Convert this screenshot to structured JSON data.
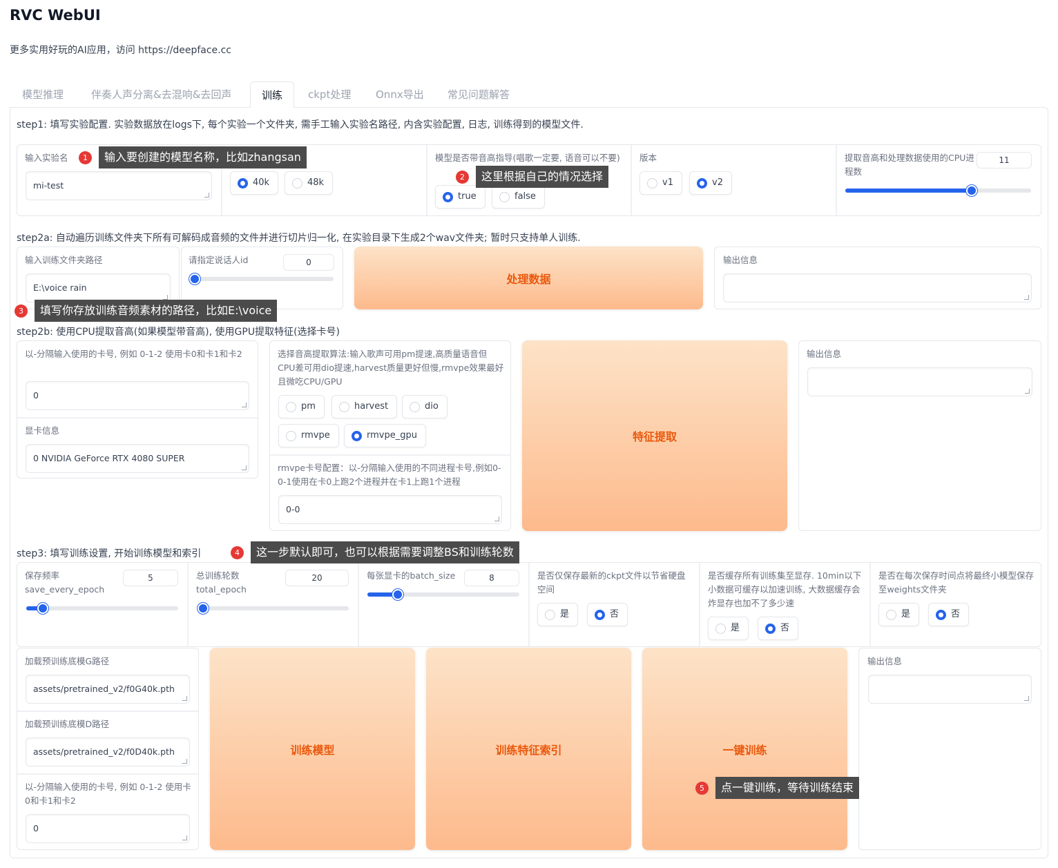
{
  "app": {
    "title": "RVC WebUI",
    "subtitle": "更多实用好玩的AI应用，访问 https://deepface.cc"
  },
  "tabs": [
    "模型推理",
    "伴奏人声分离&去混响&去回声",
    "训练",
    "ckpt处理",
    "Onnx导出",
    "常见问题解答"
  ],
  "active_tab": "训练",
  "step1": {
    "text": "step1: 填写实验配置. 实验数据放在logs下, 每个实验一个文件夹, 需手工输入实验名路径, 内含实验配置, 日志, 训练得到的模型文件.",
    "exp_name_label": "输入实验名",
    "exp_name_value": "mi-test",
    "sr_options": [
      "40k",
      "48k"
    ],
    "sr_selected": "40k",
    "pitch_label": "模型是否带音高指导(唱歌一定要, 语音可以不要)",
    "pitch_options": [
      "true",
      "false"
    ],
    "pitch_selected": "true",
    "version_label": "版本",
    "version_options": [
      "v1",
      "v2"
    ],
    "version_selected": "v2",
    "cpu_label": "提取音高和处理数据使用的CPU进程数",
    "cpu_value": "11",
    "cpu_fraction": 0.7
  },
  "step2a": {
    "text": "step2a: 自动遍历训练文件夹下所有可解码成音频的文件并进行切片归一化, 在实验目录下生成2个wav文件夹; 暂时只支持单人训练.",
    "dir_label": "输入训练文件夹路径",
    "dir_value": "E:\\voice    rain",
    "spk_label": "请指定说话人id",
    "spk_value": "0",
    "spk_fraction": 0,
    "process_button": "处理数据",
    "output_label": "输出信息"
  },
  "step2b": {
    "text": "step2b: 使用CPU提取音高(如果模型带音高), 使用GPU提取特征(选择卡号)",
    "gpus_label": "以-分隔输入使用的卡号, 例如 0-1-2 使用卡0和卡1和卡2",
    "gpus_value": "0",
    "gpu_info_label": "显卡信息",
    "gpu_info_value": "0 NVIDIA GeForce RTX 4080 SUPER",
    "f0_label": "选择音高提取算法:输入歌声可用pm提速,高质量语音但CPU差可用dio提速,harvest质量更好但慢,rmvpe效果最好且微吃CPU/GPU",
    "f0_options": [
      "pm",
      "harvest",
      "dio",
      "rmvpe",
      "rmvpe_gpu"
    ],
    "f0_selected": "rmvpe_gpu",
    "rmvpe_label": "rmvpe卡号配置：以-分隔输入使用的不同进程卡号,例如0-0-1使用在卡0上跑2个进程并在卡1上跑1个进程",
    "rmvpe_value": "0-0",
    "extract_button": "特征提取",
    "output_label": "输出信息"
  },
  "step3": {
    "text": "step3: 填写训练设置, 开始训练模型和索引",
    "save_freq_label": "保存频率save_every_epoch",
    "save_freq_value": "5",
    "save_freq_fraction": 0.1,
    "epoch_label": "总训练轮数total_epoch",
    "epoch_value": "20",
    "epoch_fraction": 0.03,
    "batch_label": "每张显卡的batch_size",
    "batch_value": "8",
    "batch_fraction": 0.2,
    "latest_label": "是否仅保存最新的ckpt文件以节省硬盘空间",
    "cache_label": "是否缓存所有训练集至显存. 10min以下小数据可缓存以加速训练, 大数据缓存会炸显存也加不了多少速",
    "weights_label": "是否在每次保存时间点将最终小模型保存至weights文件夹",
    "yes": "是",
    "no": "否",
    "latest_selected": "否",
    "cache_selected": "否",
    "weights_selected": "否",
    "pretrained_g_label": "加载预训练底模G路径",
    "pretrained_g_value": "assets/pretrained_v2/f0G40k.pth",
    "pretrained_d_label": "加载预训练底模D路径",
    "pretrained_d_value": "assets/pretrained_v2/f0D40k.pth",
    "gpus_label": "以-分隔输入使用的卡号, 例如 0-1-2 使用卡0和卡1和卡2",
    "gpus_value": "0",
    "train_button": "训练模型",
    "index_button": "训练特征索引",
    "oneclick_button": "一键训练",
    "output_label": "输出信息"
  },
  "annotations": [
    {
      "n": "1",
      "text": "输入要创建的模型名称，比如zhangsan"
    },
    {
      "n": "2",
      "text": "这里根据自己的情况选择"
    },
    {
      "n": "3",
      "text": "填写你存放训练音频素材的路径，比如E:\\voice"
    },
    {
      "n": "4",
      "text": "这一步默认即可，也可以根据需要调整BS和训练轮数"
    },
    {
      "n": "5",
      "text": "点一键训练，等待训练结束"
    }
  ],
  "colors": {
    "accent": "#2563eb",
    "button_text": "#ea580c",
    "button_bg": "#fdba8c",
    "annotation_bg": "#4b4b4b",
    "badge": "#e53935"
  }
}
